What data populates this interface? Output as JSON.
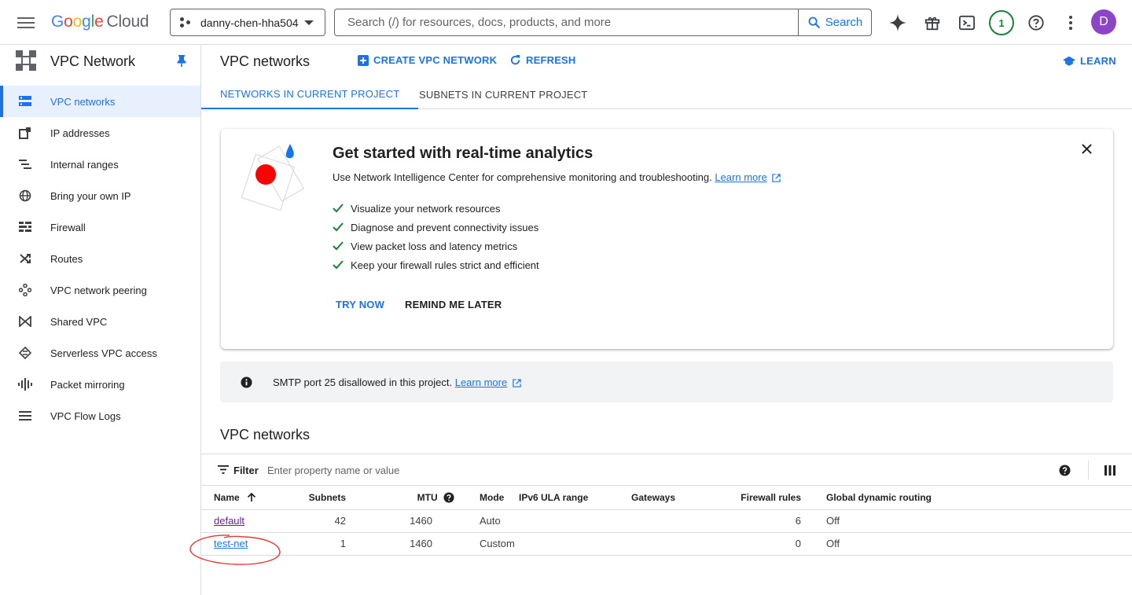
{
  "topbar": {
    "menu_icon": "hamburger-menu-icon",
    "logo": {
      "letters": [
        "G",
        "o",
        "o",
        "g",
        "l",
        "e"
      ],
      "product": "Cloud"
    },
    "project": {
      "name": "danny-chen-hha504"
    },
    "search": {
      "placeholder": "Search (/) for resources, docs, products, and more",
      "button_label": "Search"
    },
    "icons": [
      "gemini-spark-icon",
      "gift-icon",
      "cloud-shell-icon",
      "notifications-icon",
      "help-icon",
      "more-vert-icon"
    ],
    "notification_count": "1",
    "avatar_initial": "D"
  },
  "sidebar": {
    "title": "VPC Network",
    "items": [
      {
        "label": "VPC networks",
        "icon": "vpc-networks-icon",
        "active": true
      },
      {
        "label": "IP addresses",
        "icon": "ip-addresses-icon"
      },
      {
        "label": "Internal ranges",
        "icon": "internal-ranges-icon"
      },
      {
        "label": "Bring your own IP",
        "icon": "globe-icon"
      },
      {
        "label": "Firewall",
        "icon": "firewall-icon"
      },
      {
        "label": "Routes",
        "icon": "routes-icon"
      },
      {
        "label": "VPC network peering",
        "icon": "peering-icon"
      },
      {
        "label": "Shared VPC",
        "icon": "shared-vpc-icon"
      },
      {
        "label": "Serverless VPC access",
        "icon": "serverless-icon"
      },
      {
        "label": "Packet mirroring",
        "icon": "packet-mirroring-icon"
      },
      {
        "label": "VPC Flow Logs",
        "icon": "flow-logs-icon"
      }
    ]
  },
  "header": {
    "title": "VPC networks",
    "create_label": "CREATE VPC NETWORK",
    "refresh_label": "REFRESH",
    "learn_label": "LEARN"
  },
  "tabs": [
    {
      "label": "NETWORKS IN CURRENT PROJECT",
      "active": true
    },
    {
      "label": "SUBNETS IN CURRENT PROJECT",
      "active": false
    }
  ],
  "promo": {
    "title": "Get started with real-time analytics",
    "description": "Use Network Intelligence Center for comprehensive monitoring and troubleshooting.",
    "learn_more": "Learn more",
    "checklist": [
      "Visualize your network resources",
      "Diagnose and prevent connectivity issues",
      "View packet loss and latency metrics",
      "Keep your firewall rules strict and efficient"
    ],
    "try_now": "TRY NOW",
    "remind_later": "REMIND ME LATER"
  },
  "notice": {
    "text": "SMTP port 25 disallowed in this project.",
    "learn_more": "Learn more"
  },
  "networks_section": {
    "title": "VPC networks",
    "filter_label": "Filter",
    "filter_placeholder": "Enter property name or value",
    "columns": [
      "Name",
      "Subnets",
      "MTU",
      "Mode",
      "IPv6 ULA range",
      "Gateways",
      "Firewall rules",
      "Global dynamic routing"
    ],
    "rows": [
      {
        "name": "default",
        "subnets": "42",
        "mtu": "1460",
        "mode": "Auto",
        "ipv6": "",
        "gateways": "",
        "firewall_rules": "6",
        "routing": "Off"
      },
      {
        "name": "test-net",
        "subnets": "1",
        "mtu": "1460",
        "mode": "Custom",
        "ipv6": "",
        "gateways": "",
        "firewall_rules": "0",
        "routing": "Off"
      }
    ]
  },
  "colors": {
    "accent": "#1a73e8",
    "visited_link": "#681da8",
    "annotation": "#e53935",
    "success": "#188038"
  }
}
